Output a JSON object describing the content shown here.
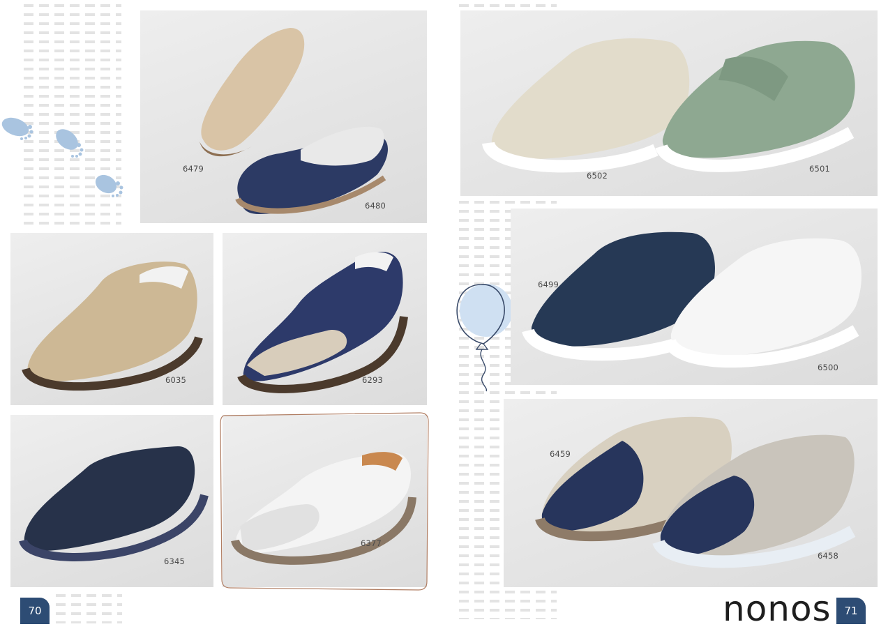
{
  "pages": {
    "left_number": "70",
    "right_number": "71"
  },
  "brand": {
    "name": "nonos"
  },
  "products": [
    {
      "code": "6479",
      "color": "#d9c4a6",
      "sole": "#a7896c"
    },
    {
      "code": "6480",
      "color": "#2c3a64",
      "sole": "#a7896c"
    },
    {
      "code": "6035",
      "color": "#cdb895",
      "sole": "#4b3a2c"
    },
    {
      "code": "6293",
      "color": "#2d3a6a",
      "sole": "#4b3a2c"
    },
    {
      "code": "6345",
      "color": "#27324a",
      "sole": "#3b4467"
    },
    {
      "code": "6377",
      "color": "#f4f4f4",
      "sole": "#8a7866"
    },
    {
      "code": "6502",
      "color": "#e2dccb",
      "sole": "#ffffff"
    },
    {
      "code": "6501",
      "color": "#8ea891",
      "sole": "#ffffff"
    },
    {
      "code": "6499",
      "color": "#263955",
      "sole": "#ffffff"
    },
    {
      "code": "6500",
      "color": "#f6f6f6",
      "sole": "#ffffff"
    },
    {
      "code": "6459",
      "color": "#27355c",
      "sole": "#8e7b68"
    },
    {
      "code": "6458",
      "color": "#27355c",
      "sole": "#e8eef4"
    }
  ],
  "decor": {
    "accent": "#a9c4e0",
    "page_badge": "#2d4c74",
    "balloon": "#cfe0f2"
  }
}
